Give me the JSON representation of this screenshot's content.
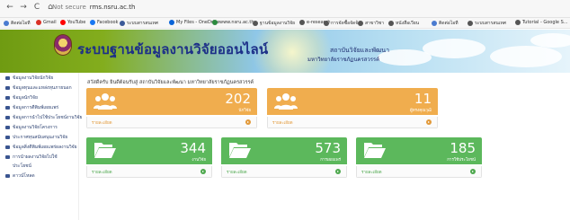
{
  "browser": {
    "nav_back": "←",
    "nav_forward": "→",
    "nav_reload": "C",
    "nav_home": "⌂",
    "security": "Not secure",
    "url": "rms.nsru.ac.th"
  },
  "bookmarks": [
    {
      "label": "ติดต่อไอที",
      "color": "#4a7bd0"
    },
    {
      "label": "Gmail",
      "color": "#d93025"
    },
    {
      "label": "YouTube",
      "color": "#ff0000"
    },
    {
      "label": "Facebook",
      "color": "#1877f2"
    },
    {
      "label": "ระบบสารสนเทศ",
      "color": "#3b5998"
    },
    {
      "label": "My Files - OneDrive",
      "color": "#0a64d8"
    },
    {
      "label": "www.nsru.ac.th",
      "color": "#2b8a3e"
    },
    {
      "label": "ฐานข้อมูลงานวิจัย",
      "color": "#555555"
    },
    {
      "label": "e-research",
      "color": "#555555"
    },
    {
      "label": "การจัดซื้อจัดจ้าง",
      "color": "#555555"
    },
    {
      "label": "สาขาวิชา",
      "color": "#555555"
    },
    {
      "label": "หนังสือเวียน",
      "color": "#555555"
    },
    {
      "label": "ติดต่อไอที",
      "color": "#4a7bd0"
    },
    {
      "label": "ระบบสารสนเทศ",
      "color": "#555555"
    },
    {
      "label": "Tutorial - Google S...",
      "color": "#555555"
    }
  ],
  "banner": {
    "title": "ระบบฐานข้อมูลงานวิจัยออนไลน์",
    "university": "สถาบันวิจัยและพัฒนา",
    "university_sub": "มหาวิทยาลัยราชภัฏนครสวรรค์"
  },
  "sidebar": [
    "ข้อมูลงานวิจัยนักวิจัย",
    "ข้อมูลทุนและแหล่งทุนภายนอก",
    "ข้อมูลนักวิจัย",
    "ข้อมูลการตีพิมพ์เผยแพร่",
    "ข้อมูลการนำไปใช้ประโยชน์งานวิจัย",
    "ข้อมูลงานวิจัยโครงการ",
    "ประกาศทุนสนับสนุนงานวิจัย",
    "ข้อมูลสิ่งตีพิมพ์เผยแพร่ผลงานวิจัย",
    "การนำผลงานวิจัยไปใช้",
    "ประโยชน์",
    "ดาวน์โหลด"
  ],
  "main": {
    "welcome": "สวัสดีครับ ยินดีต้อนรับสู่ สถาบันวิจัยและพัฒนา มหาวิทยาลัยราชภัฏนครสวรรค์"
  },
  "cards": [
    {
      "value": "202",
      "label": "นักวิจัย",
      "more": "รายละเอียด",
      "icon": "users-icon",
      "color": "#f0ad4e"
    },
    {
      "value": "11",
      "label": "ผู้ทรงคุณวุฒิ",
      "more": "รายละเอียด",
      "icon": "users-icon",
      "color": "#f0ad4e"
    },
    {
      "value": "344",
      "label": "งานวิจัย",
      "more": "รายละเอียด",
      "icon": "folder-open-icon",
      "color": "#5cb85c"
    },
    {
      "value": "573",
      "label": "การเผยแพร่",
      "more": "รายละเอียด",
      "icon": "folder-open-icon",
      "color": "#5cb85c"
    },
    {
      "value": "185",
      "label": "การใช้ประโยชน์",
      "more": "รายละเอียด",
      "icon": "folder-open-icon",
      "color": "#5cb85c"
    }
  ]
}
